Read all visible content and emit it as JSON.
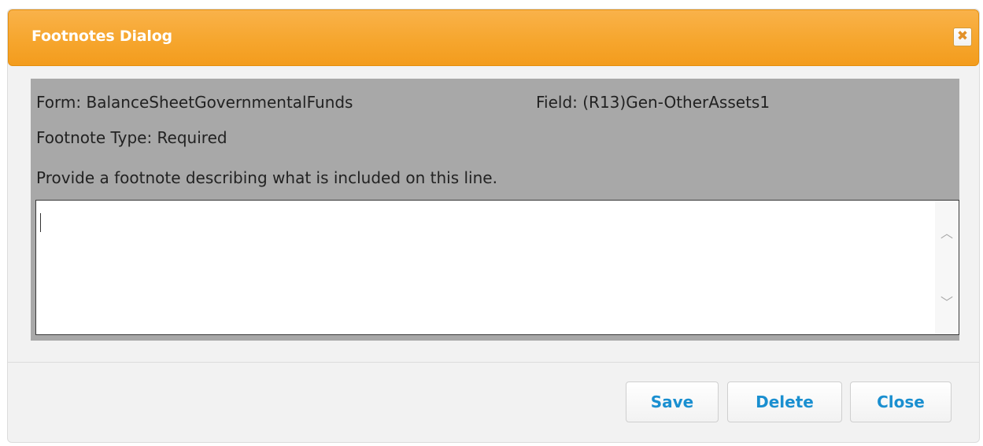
{
  "dialog": {
    "title": "Footnotes Dialog",
    "close_icon": "close-icon",
    "close_glyph": "✖"
  },
  "info": {
    "form": "Form: BalanceSheetGovernmentalFunds",
    "field": "Field: (R13)Gen-OtherAssets1",
    "footnote_type": "Footnote Type: Required",
    "prompt": "Provide a footnote describing what is included on this line."
  },
  "textarea": {
    "value": "",
    "scroll_up_glyph": "︿",
    "scroll_down_glyph": "﹀"
  },
  "buttons": {
    "save": "Save",
    "delete": "Delete",
    "close": "Close"
  },
  "colors": {
    "titlebar": "#f6a62e",
    "content_bg": "#a8a8a8",
    "button_text": "#1a8fd0"
  }
}
